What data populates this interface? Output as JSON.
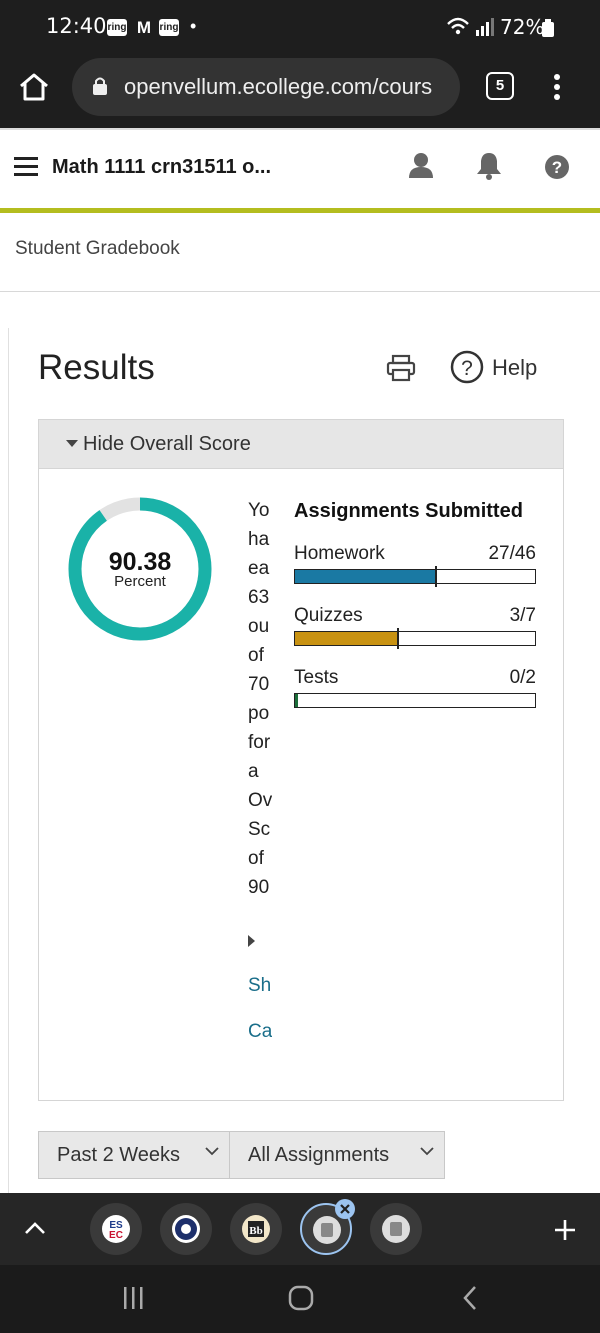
{
  "status_bar": {
    "time": "12:40",
    "notif_icons": [
      "ring",
      "gmail",
      "ring"
    ],
    "battery": "72%"
  },
  "browser": {
    "url": "openvellum.ecollege.com/cours",
    "tab_count": "5"
  },
  "app_header": {
    "title": "Math 1111 crn31511 o..."
  },
  "breadcrumb": "Student Gradebook",
  "page": {
    "title": "Results",
    "help_label": "Help"
  },
  "overall": {
    "toggle_label": "Hide Overall Score",
    "score": "90.38",
    "score_fraction": 0.9038,
    "score_unit": "Percent",
    "summary_lines": [
      "Yo",
      "ha",
      "ea",
      "63",
      "ou",
      "of",
      "70",
      "po",
      "for",
      "a",
      "Ov",
      "Sc",
      "of",
      "90"
    ],
    "links": [
      "Sh",
      "Ca"
    ]
  },
  "assignments": {
    "heading": "Assignments Submitted",
    "items": [
      {
        "name": "Homework",
        "count": "27/46",
        "fraction": 0.587,
        "color": "#1a79a3"
      },
      {
        "name": "Quizzes",
        "count": "3/7",
        "fraction": 0.4286,
        "color": "#c89212"
      },
      {
        "name": "Tests",
        "count": "0/2",
        "fraction": 0.0,
        "color": "#1b6e3a"
      }
    ]
  },
  "filters": {
    "period": "Past 2 Weeks",
    "type": "All Assignments"
  },
  "colors": {
    "accent_line": "#b4bd1f",
    "ring": "#1ab2a8"
  }
}
